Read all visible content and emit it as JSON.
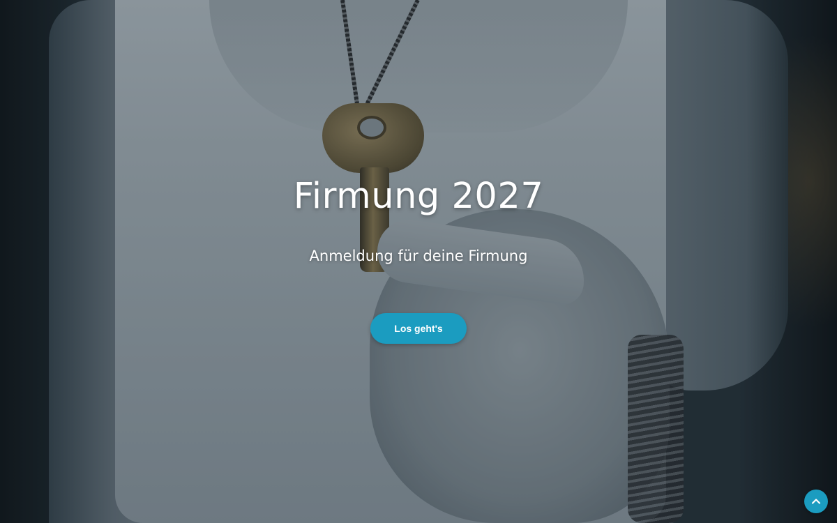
{
  "hero": {
    "title": "Firmung 2027",
    "subtitle": "Anmeldung für deine Firmung",
    "cta_label": "Los geht's"
  },
  "background": {
    "description_icon": "key-pendant-photo"
  },
  "scroll_to_top": {
    "icon": "chevron-up-icon"
  },
  "colors": {
    "accent": "#1b9cc0",
    "text": "#ffffff"
  }
}
